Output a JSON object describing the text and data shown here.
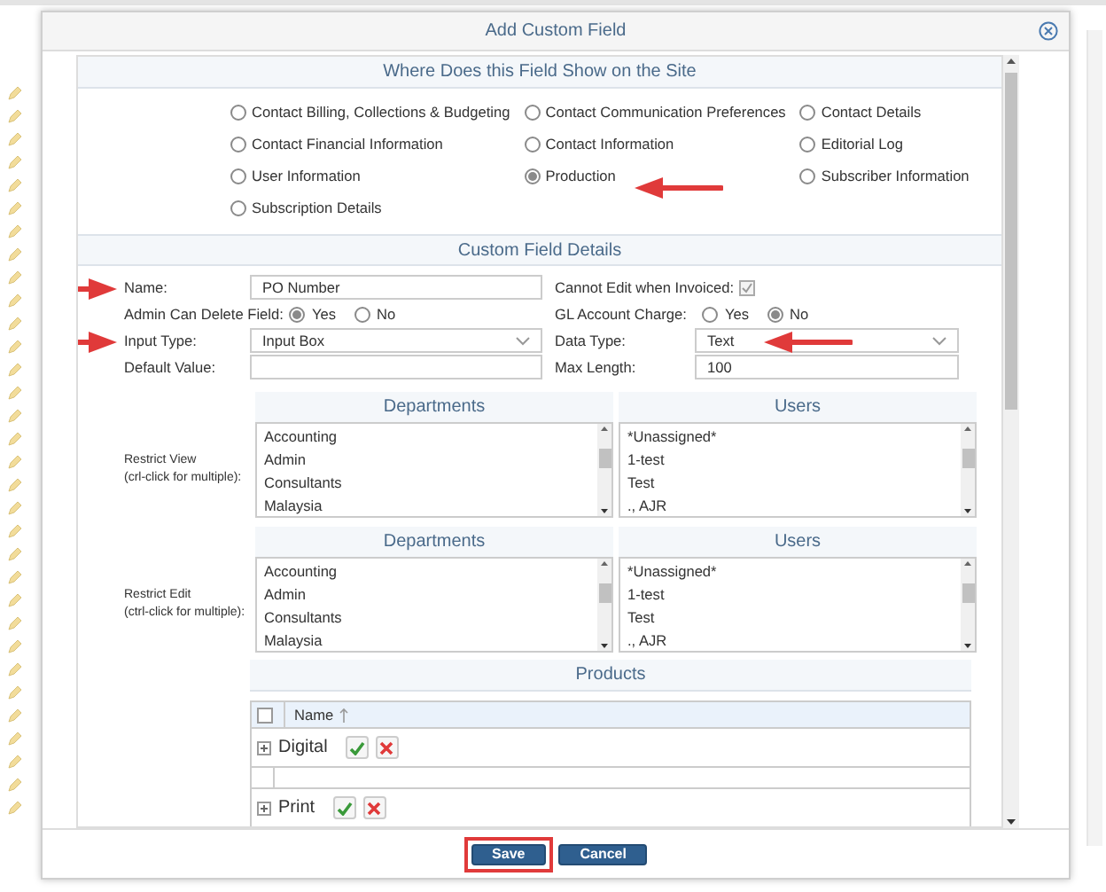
{
  "dialog": {
    "title": "Add Custom Field"
  },
  "location_section": {
    "heading": "Where Does this Field Show on the Site",
    "options": [
      {
        "label": "Contact Billing, Collections & Budgeting",
        "selected": false
      },
      {
        "label": "Contact Communication Preferences",
        "selected": false
      },
      {
        "label": "Contact Details",
        "selected": false
      },
      {
        "label": "Contact Financial Information",
        "selected": false
      },
      {
        "label": "Contact Information",
        "selected": false
      },
      {
        "label": "Editorial Log",
        "selected": false
      },
      {
        "label": "User Information",
        "selected": false
      },
      {
        "label": "Production",
        "selected": true,
        "pointed_at": true
      },
      {
        "label": "Subscriber Information",
        "selected": false
      },
      {
        "label": "Subscription Details",
        "selected": false
      }
    ]
  },
  "details_section": {
    "heading": "Custom Field Details",
    "name": {
      "label": "Name:",
      "value": "PO Number",
      "pointed_at": true
    },
    "cannot_edit": {
      "label": "Cannot Edit when Invoiced:",
      "checked": true
    },
    "admin_can_delete": {
      "label": "Admin Can Delete Field:",
      "options": [
        {
          "label": "Yes",
          "selected": true
        },
        {
          "label": "No",
          "selected": false
        }
      ]
    },
    "gl_account_charge": {
      "label": "GL Account Charge:",
      "options": [
        {
          "label": "Yes",
          "selected": false
        },
        {
          "label": "No",
          "selected": true
        }
      ]
    },
    "input_type": {
      "label": "Input Type:",
      "value": "Input Box",
      "pointed_at": true
    },
    "data_type": {
      "label": "Data Type:",
      "value": "Text",
      "pointed_at": true
    },
    "default_value": {
      "label": "Default Value:"
    },
    "max_length": {
      "label": "Max Length:",
      "value": "100"
    }
  },
  "restrictions": [
    {
      "label": "Restrict View",
      "hint": "(crl-click for multiple):",
      "lists": [
        {
          "heading": "Departments",
          "items": [
            "Accounting",
            "Admin",
            "Consultants",
            "Malaysia"
          ]
        },
        {
          "heading": "Users",
          "items": [
            "*Unassigned*",
            "1-test",
            "Test",
            "., AJR"
          ]
        }
      ]
    },
    {
      "label": "Restrict Edit",
      "hint": "(ctrl-click for multiple):",
      "lists": [
        {
          "heading": "Departments",
          "items": [
            "Accounting",
            "Admin",
            "Consultants",
            "Malaysia"
          ]
        },
        {
          "heading": "Users",
          "items": [
            "*Unassigned*",
            "1-test",
            "Test",
            "., AJR"
          ]
        }
      ]
    }
  ],
  "products": {
    "heading": "Products",
    "select_all": {
      "checked": false
    },
    "columns": [
      {
        "label": "Name",
        "sorted_ascending": true
      }
    ],
    "rows": [
      {
        "kind": "product",
        "name": "Digital"
      },
      {
        "kind": "blank"
      },
      {
        "kind": "product",
        "name": "Print"
      }
    ]
  },
  "buttons": [
    {
      "label": "Save",
      "highlighted": true
    },
    {
      "label": "Cancel",
      "highlighted": false
    }
  ]
}
